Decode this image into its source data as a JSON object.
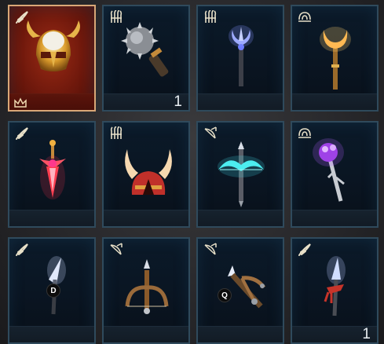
{
  "slots": [
    {
      "item_icon": "horned-golden-helmet-icon",
      "class_icon": "feather-class-icon",
      "selected": true,
      "tier_icon": "crown-icon",
      "count": ""
    },
    {
      "item_icon": "spiked-mace-icon",
      "class_icon": "claw-class-icon",
      "count": "1"
    },
    {
      "item_icon": "trident-staff-icon",
      "class_icon": "claw-class-icon",
      "count": ""
    },
    {
      "item_icon": "golden-crescent-staff-icon",
      "class_icon": "spiral-class-icon",
      "count": ""
    },
    {
      "item_icon": "red-flame-dagger-icon",
      "class_icon": "feather-class-icon",
      "count": ""
    },
    {
      "item_icon": "horned-red-helmet-icon",
      "class_icon": "claw-class-icon",
      "count": ""
    },
    {
      "item_icon": "cyan-crossbow-icon",
      "class_icon": "bow-class-icon",
      "count": ""
    },
    {
      "item_icon": "purple-orb-staff-icon",
      "class_icon": "spiral-class-icon",
      "count": ""
    },
    {
      "item_icon": "white-spear-icon",
      "class_icon": "feather-class-icon",
      "count": "",
      "key": "D"
    },
    {
      "item_icon": "wooden-crossbow-icon",
      "class_icon": "bow-class-icon",
      "count": ""
    },
    {
      "item_icon": "ballista-crossbow-icon",
      "class_icon": "bow-class-icon",
      "count": "",
      "key": "Q"
    },
    {
      "item_icon": "red-tassel-spear-icon",
      "class_icon": "feather-class-icon",
      "count": "1"
    }
  ],
  "colors": {
    "slot_border": "#2f4a5c",
    "selected_border": "#d9a777",
    "selected_bg": "#7a1c0e"
  }
}
